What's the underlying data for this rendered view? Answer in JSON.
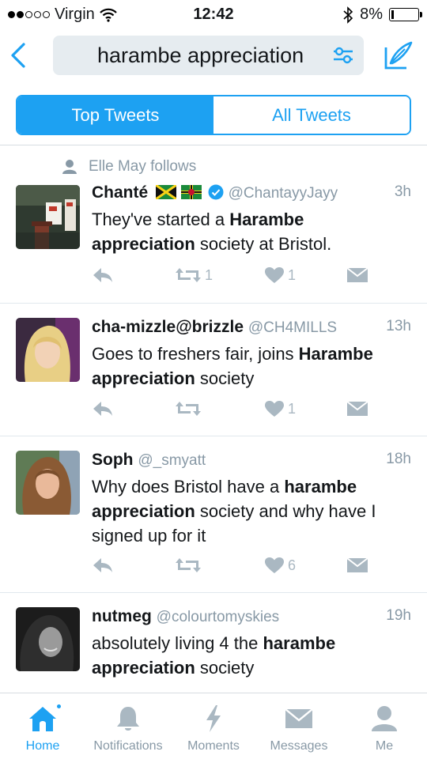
{
  "status_bar": {
    "carrier": "Virgin",
    "time": "12:42",
    "battery": "8%",
    "battery_level": 0.08
  },
  "search": {
    "query": "harambe appreciation"
  },
  "segments": {
    "top": "Top Tweets",
    "all": "All Tweets"
  },
  "tweets": [
    {
      "social_context": "Elle May follows",
      "name": "Chanté",
      "handle": "@ChantayyJayy",
      "time": "3h",
      "text_parts": [
        "They've started a ",
        "Harambe appreciation",
        " society at Bristol."
      ],
      "retweets": "1",
      "likes": "1"
    },
    {
      "name": "cha-mizzle@brizzle",
      "handle": "@CH4MILLS",
      "time": "13h",
      "text_parts": [
        "Goes to freshers fair, joins ",
        "Harambe appreciation",
        " society"
      ],
      "retweets": "",
      "likes": "1"
    },
    {
      "name": "Soph",
      "handle": "@_smyatt",
      "time": "18h",
      "text_parts": [
        "Why does Bristol have a ",
        "harambe appreciation",
        " society and why have I signed up for it"
      ],
      "retweets": "",
      "likes": "6"
    },
    {
      "name": "nutmeg",
      "handle": "@colourtomyskies",
      "time": "19h",
      "text_parts": [
        "absolutely living 4 the ",
        "harambe appreciation",
        " society"
      ],
      "retweets": "",
      "likes": ""
    }
  ],
  "tabs": [
    "Home",
    "Notifications",
    "Moments",
    "Messages",
    "Me"
  ],
  "colors": {
    "accent": "#1da1f2",
    "icon_gray": "#aab8c2",
    "text_gray": "#8899a6",
    "verified": "#1da1f2"
  }
}
